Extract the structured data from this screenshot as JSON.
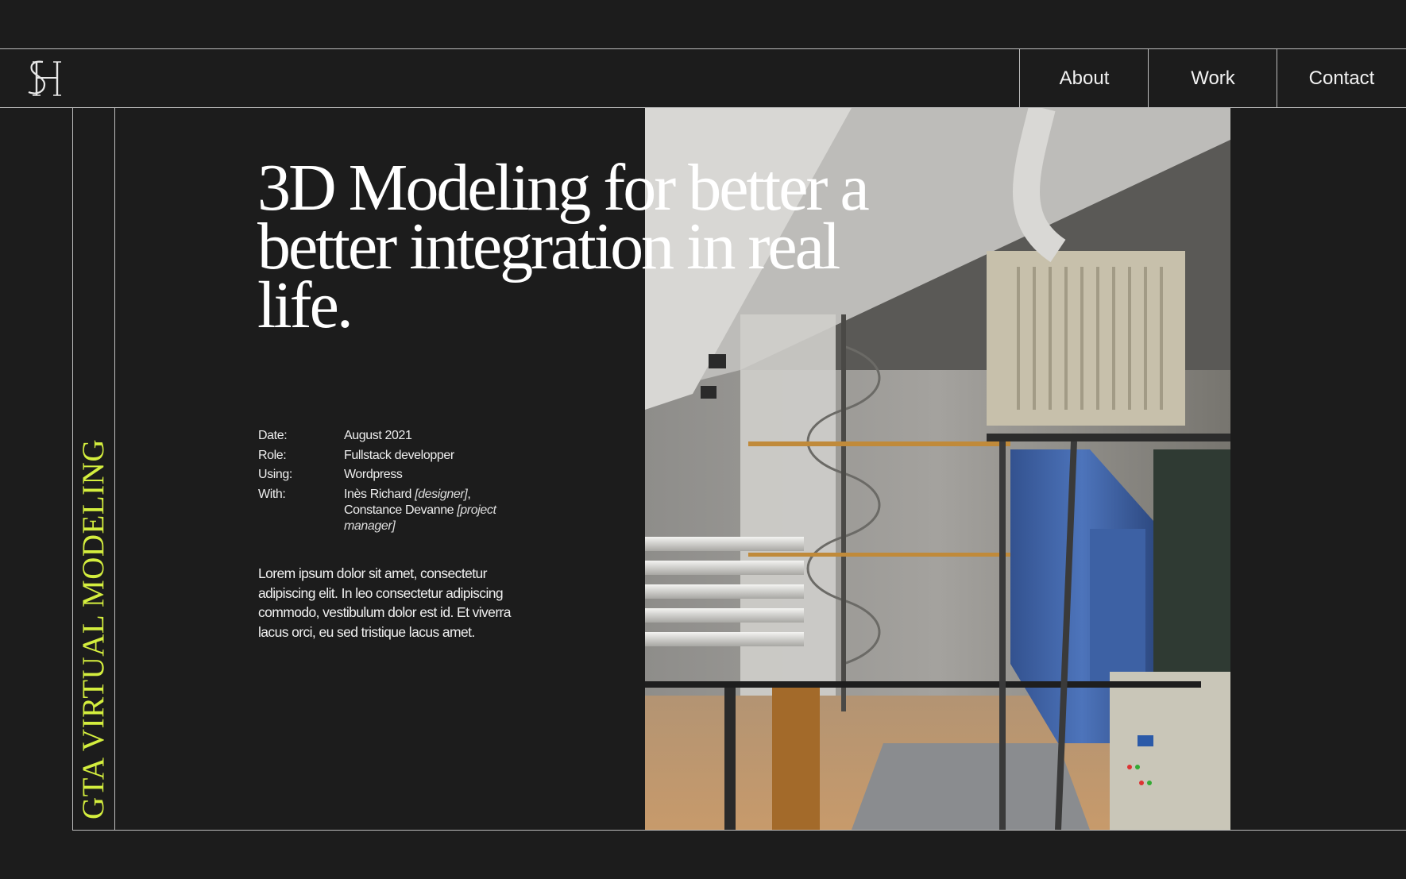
{
  "logo": {
    "initials": "SH"
  },
  "nav": {
    "items": [
      {
        "label": "About"
      },
      {
        "label": "Work"
      },
      {
        "label": "Contact"
      }
    ]
  },
  "project": {
    "side_label": "GTA VIRTUAL MODELING",
    "title": "3D Modeling for better a better integration in real life.",
    "meta": {
      "date_label": "Date:",
      "date": "August 2021",
      "role_label": "Role:",
      "role": "Fullstack developper",
      "using_label": "Using:",
      "using": "Wordpress",
      "with_label": "With:",
      "collab1_name": "Inès Richard",
      "collab1_role": "[designer]",
      "collab1_sep": ",",
      "collab2_name": "Constance Devanne",
      "collab2_role": "[project manager]"
    },
    "description": "Lorem ipsum dolor sit amet, consectetur adipiscing elit. In leo consectetur adipiscing commodo, vestibulum dolor est id. Et viverra lacus orci, eu sed tristique lacus amet."
  },
  "colors": {
    "background": "#1c1c1c",
    "accent": "#d4ee3e",
    "lines": "#bdbdbd"
  },
  "image": {
    "subject": "industrial-interior-3d-render"
  }
}
